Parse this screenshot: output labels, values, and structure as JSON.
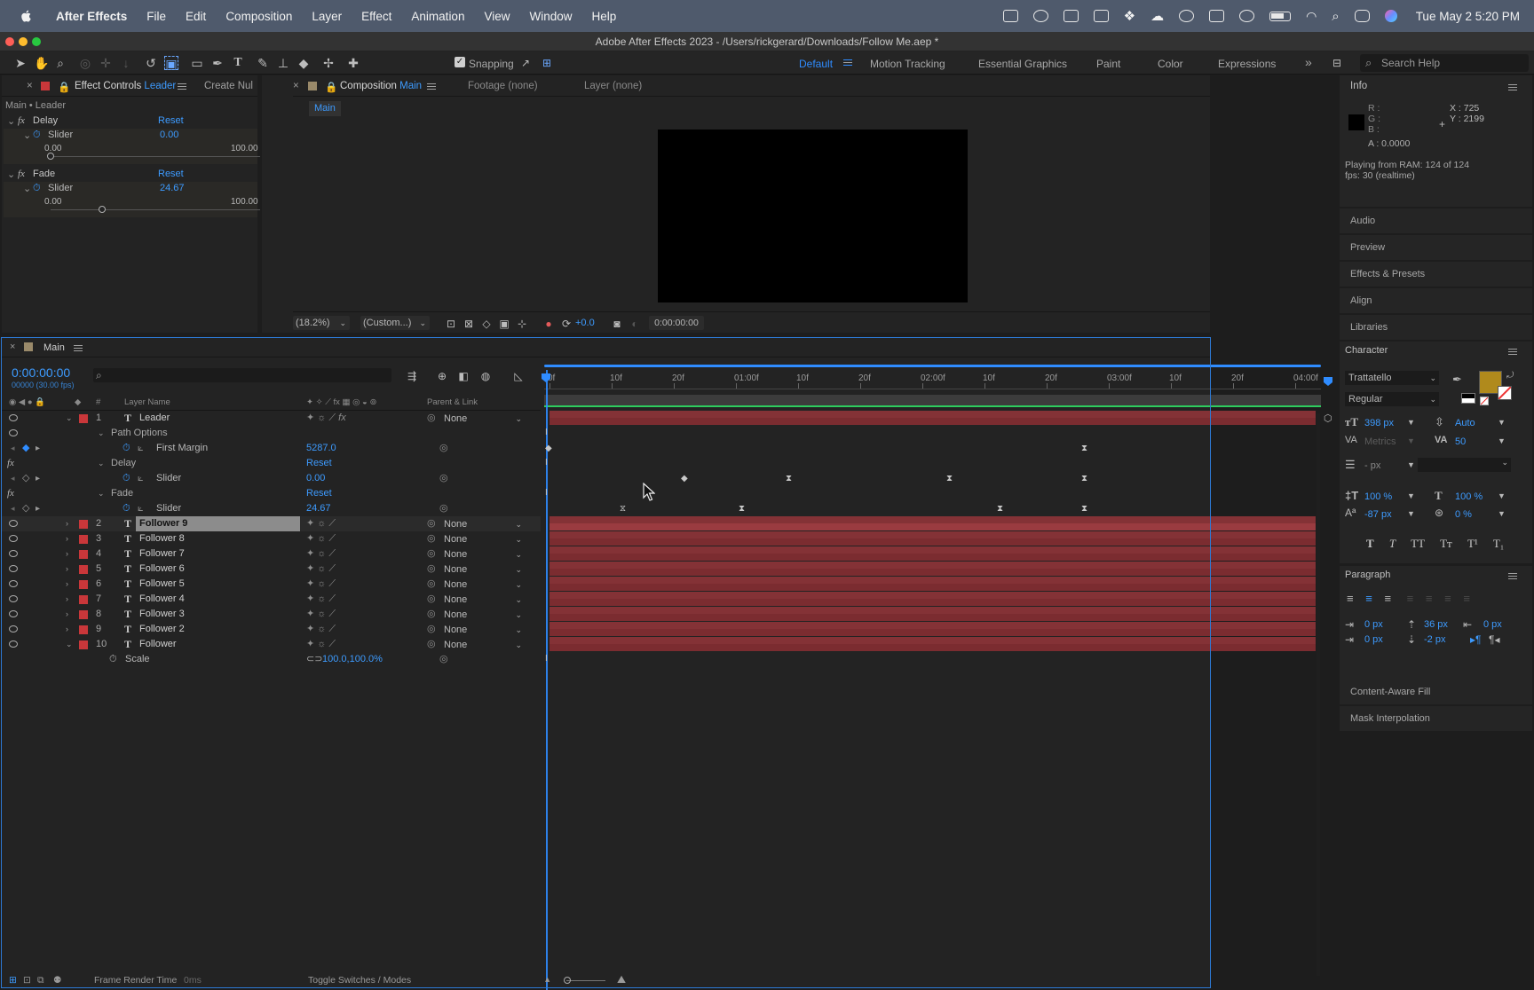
{
  "menubar": {
    "app": "After Effects",
    "items": [
      "File",
      "Edit",
      "Composition",
      "Layer",
      "Effect",
      "Animation",
      "View",
      "Window",
      "Help"
    ],
    "clock": "Tue May 2  5:20 PM"
  },
  "window": {
    "title": "Adobe After Effects 2023 - /Users/rickgerard/Downloads/Follow Me.aep *"
  },
  "toolbar": {
    "snapping": "Snapping",
    "workspaces": [
      "Default",
      "Motion Tracking",
      "Essential Graphics",
      "Paint",
      "Color",
      "Expressions"
    ],
    "search_placeholder": "Search Help"
  },
  "effect_controls": {
    "tab_prefix": "Effect Controls",
    "tab_layer": "Leader",
    "tab2": "Create Nul",
    "breadcrumb": "Main • Leader",
    "effects": [
      {
        "name": "Delay",
        "reset": "Reset",
        "param": "Slider",
        "value": "0.00",
        "min": "0.00",
        "max": "100.00",
        "fraction": 0.0
      },
      {
        "name": "Fade",
        "reset": "Reset",
        "param": "Slider",
        "value": "24.67",
        "min": "0.00",
        "max": "100.00",
        "fraction": 0.2467
      }
    ]
  },
  "composition": {
    "tab_prefix": "Composition",
    "tab_comp": "Main",
    "footage": "Footage (none)",
    "layer": "Layer (none)",
    "breadcrumb": "Main",
    "zoom": "(18.2%)",
    "resolution": "(Custom...)",
    "exposure": "+0.0",
    "timecode": "0:00:00:00"
  },
  "timeline": {
    "comp_name": "Main",
    "timecode": "0:00:00:00",
    "frame_info": "00000 (30.00 fps)",
    "search_placeholder": "",
    "header": {
      "layer_name": "Layer Name",
      "hash": "#",
      "parent": "Parent & Link"
    },
    "ruler": [
      "0f",
      "10f",
      "20f",
      "01:00f",
      "10f",
      "20f",
      "02:00f",
      "10f",
      "20f",
      "03:00f",
      "10f",
      "20f",
      "04:00f"
    ],
    "layers": [
      {
        "num": "1",
        "name": "Leader",
        "parent": "None",
        "expanded": true
      },
      {
        "num": "2",
        "name": "Follower 9",
        "parent": "None",
        "selected": true
      },
      {
        "num": "3",
        "name": "Follower 8",
        "parent": "None"
      },
      {
        "num": "4",
        "name": "Follower 7",
        "parent": "None"
      },
      {
        "num": "5",
        "name": "Follower 6",
        "parent": "None"
      },
      {
        "num": "6",
        "name": "Follower 5",
        "parent": "None"
      },
      {
        "num": "7",
        "name": "Follower 4",
        "parent": "None"
      },
      {
        "num": "8",
        "name": "Follower 3",
        "parent": "None"
      },
      {
        "num": "9",
        "name": "Follower 2",
        "parent": "None"
      },
      {
        "num": "10",
        "name": "Follower",
        "parent": "None",
        "expanded": true
      }
    ],
    "props": {
      "path_options": "Path Options",
      "first_margin": "First Margin",
      "first_margin_value": "5287.0",
      "delay": "Delay",
      "delay_reset": "Reset",
      "slider": "Slider",
      "delay_value": "0.00",
      "fade": "Fade",
      "fade_reset": "Reset",
      "fade_value": "24.67",
      "scale": "Scale",
      "scale_value": "100.0,100.0%"
    },
    "footer": {
      "render_time_label": "Frame Render Time",
      "render_time_value": "0ms",
      "toggle": "Toggle Switches / Modes"
    }
  },
  "info_panel": {
    "title": "Info",
    "r": "R :",
    "g": "G :",
    "b": "B :",
    "a": "A :  0.0000",
    "x": "X : 725",
    "y": "Y : 2199",
    "status1": "Playing from RAM: 124 of 124",
    "status2": "fps: 30 (realtime)"
  },
  "collapsed_panels": [
    "Audio",
    "Preview",
    "Effects & Presets",
    "Align",
    "Libraries"
  ],
  "character": {
    "title": "Character",
    "font": "Trattatello",
    "style": "Regular",
    "size": "398 px",
    "leading": "Auto",
    "kerning": "Metrics",
    "tracking": "50",
    "stroke": "- px",
    "vscale": "100 %",
    "hscale": "100 %",
    "baseline": "-87 px",
    "tsume": "0 %",
    "fill_color": "#b08a1c"
  },
  "paragraph": {
    "title": "Paragraph",
    "indent_left": "0 px",
    "space_before": "36 px",
    "indent_right": "0 px",
    "first_line": "0 px",
    "space_after": "-2 px"
  },
  "bottom_panels": [
    "Content-Aware Fill",
    "Mask Interpolation"
  ]
}
